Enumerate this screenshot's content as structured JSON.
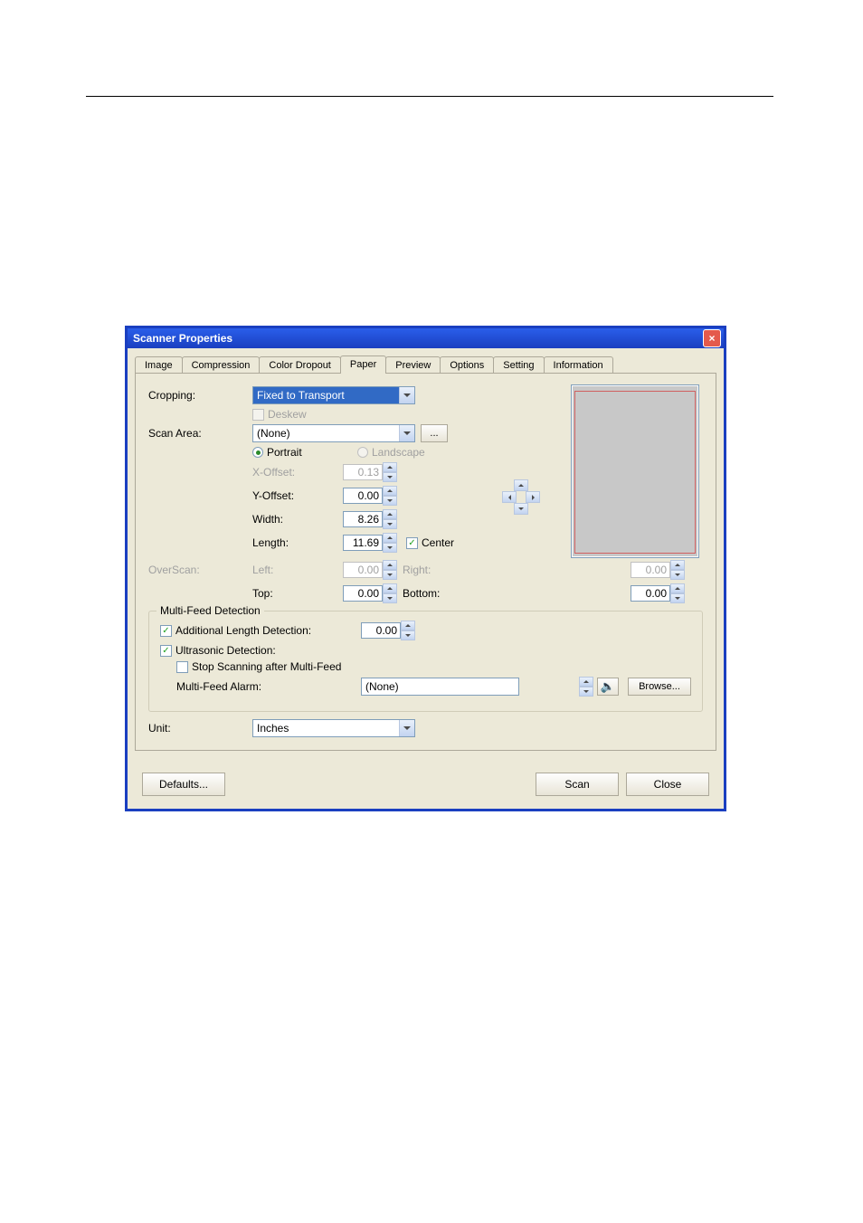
{
  "window": {
    "title": "Scanner Properties"
  },
  "tabs": {
    "image": "Image",
    "compression": "Compression",
    "colordropout": "Color Dropout",
    "paper": "Paper",
    "preview": "Preview",
    "options": "Options",
    "setting": "Setting",
    "information": "Information"
  },
  "labels": {
    "cropping": "Cropping:",
    "deskew": "Deskew",
    "scanarea": "Scan Area:",
    "portrait": "Portrait",
    "landscape": "Landscape",
    "xoffset": "X-Offset:",
    "yoffset": "Y-Offset:",
    "width": "Width:",
    "length": "Length:",
    "center": "Center",
    "overscan": "OverScan:",
    "left": "Left:",
    "right": "Right:",
    "top": "Top:",
    "bottom": "Bottom:",
    "mf_group": "Multi-Feed Detection",
    "mf_addlen": "Additional Length Detection:",
    "mf_ultra": "Ultrasonic Detection:",
    "mf_stop": "Stop Scanning after Multi-Feed",
    "mf_alarm": "Multi-Feed Alarm:",
    "browse": "Browse...",
    "unit": "Unit:",
    "defaults": "Defaults...",
    "scan": "Scan",
    "close": "Close",
    "ellipsis": "..."
  },
  "values": {
    "cropping": "Fixed to Transport",
    "scanarea": "(None)",
    "xoffset": "0.13",
    "yoffset": "0.00",
    "width": "8.26",
    "length": "11.69",
    "over_left": "0.00",
    "over_right": "0.00",
    "over_top": "0.00",
    "over_bottom": "0.00",
    "mf_addlen": "0.00",
    "mf_alarm": "(None)",
    "unit": "Inches"
  }
}
